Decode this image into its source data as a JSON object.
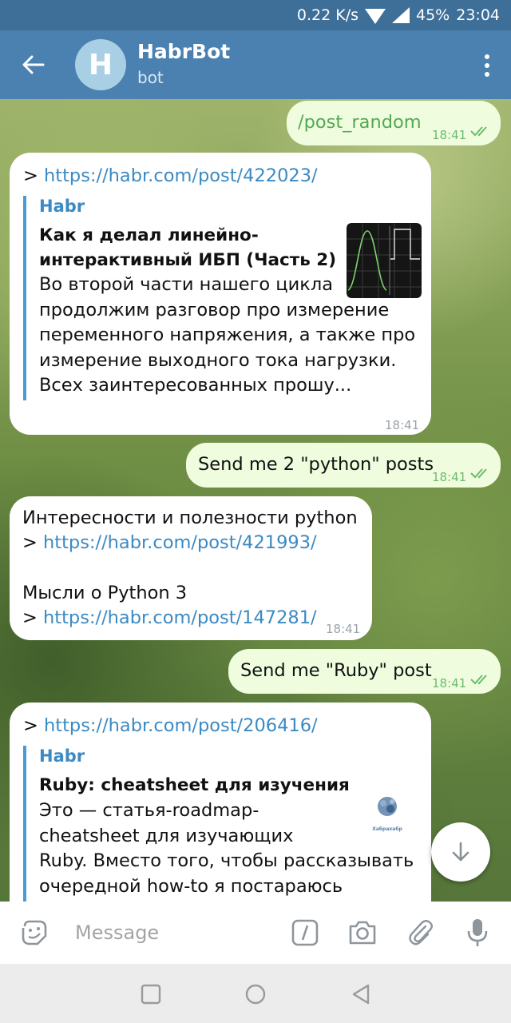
{
  "status_bar": {
    "speed": "0.22 K/s",
    "battery": "45%",
    "time": "23:04"
  },
  "header": {
    "avatar_letter": "H",
    "title": "HabrBot",
    "subtitle": "bot"
  },
  "messages": {
    "m1": {
      "text": "/post_random",
      "time": "18:41"
    },
    "m2": {
      "prefix": "> ",
      "link": "https://habr.com/post/422023/",
      "site": "Habr",
      "title_lines": [
        "Как я делал линейно-",
        "интерактивный ИБП (Часть 2)"
      ],
      "desc_lines": [
        "Во второй части нашего цикла",
        "продолжим разговор про измерение",
        "переменного напряжения, а также про",
        "измерение выходного тока нагрузки.",
        "Всех заинтересованных прошу..."
      ],
      "time": "18:41"
    },
    "m3": {
      "text": "Send me 2 \"python\" posts",
      "time": "18:41"
    },
    "m4": {
      "line1": "Интересности и полезности python",
      "prefix1": "> ",
      "link1": "https://habr.com/post/421993/",
      "line3": "Мысли о Python 3",
      "prefix2": "> ",
      "link2": "https://habr.com/post/147281/",
      "time": "18:41"
    },
    "m5": {
      "text": "Send me \"Ruby\" post",
      "time": "18:41"
    },
    "m6": {
      "prefix": "> ",
      "link": "https://habr.com/post/206416/",
      "site": "Habr",
      "title": "Ruby: cheatsheet для изучения",
      "thumb_caption": "Хабрахабр",
      "desc_lines": [
        "Это — статья-roadmap-",
        "cheatsheet для изучающих",
        "Ruby. Вместо того, чтобы рассказывать",
        "очередной how-to я постараюсь"
      ]
    }
  },
  "input": {
    "placeholder": "Message"
  },
  "colors": {
    "header": "#4a81b0",
    "status_bar": "#3e6f98",
    "outgoing_bubble": "#effdde",
    "link": "#3b8ac3",
    "check": "#6dbb6f"
  },
  "icons": [
    "back-arrow-icon",
    "more-vert-icon",
    "scroll-down-icon",
    "sticker-icon",
    "bot-command-icon",
    "camera-icon",
    "attach-icon",
    "mic-icon",
    "nav-square-icon",
    "nav-circle-icon",
    "nav-back-icon"
  ]
}
